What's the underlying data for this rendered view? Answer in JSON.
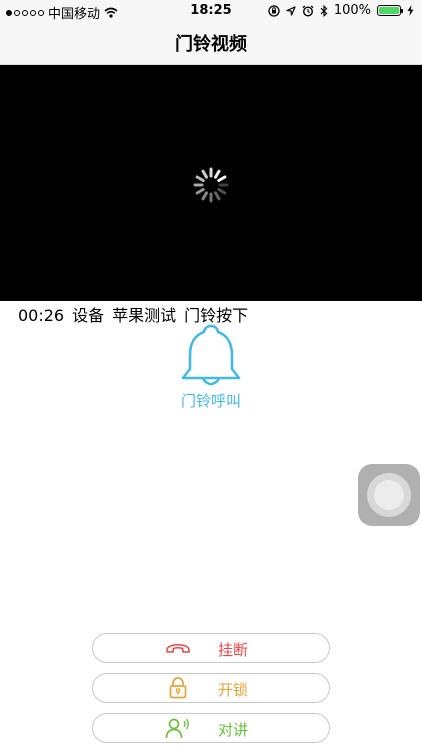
{
  "status_bar": {
    "carrier": "中国移动",
    "time": "18:25",
    "battery": "100%",
    "battery_level": 1.0,
    "icons": [
      "signal-dots",
      "wifi-icon",
      "orientation-lock-icon",
      "location-icon",
      "alarm-icon",
      "bluetooth-icon",
      "battery-icon",
      "charging-icon"
    ]
  },
  "nav": {
    "title": "门铃视频"
  },
  "video": {
    "state": "loading",
    "icon": "spinner-icon",
    "background": "#000000"
  },
  "event": {
    "time": "00:26",
    "device_label": "设备",
    "device_name": "苹果测试",
    "action": "门铃按下"
  },
  "bell": {
    "icon": "bell-icon",
    "label": "门铃呼叫",
    "color": "#43b9e6"
  },
  "actions": [
    {
      "label": "挂断",
      "icon": "phone-hangup-icon",
      "color": "#e8484a"
    },
    {
      "label": "开锁",
      "icon": "lock-icon",
      "color": "#e5a437"
    },
    {
      "label": "对讲",
      "icon": "talk-icon",
      "color": "#6bc13c"
    }
  ]
}
